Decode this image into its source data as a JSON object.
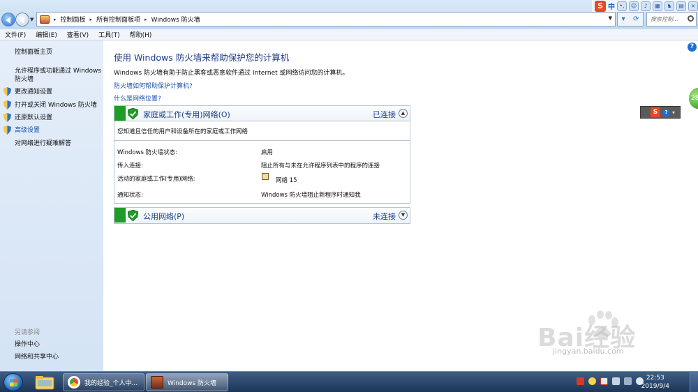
{
  "address": {
    "crumbs": [
      "控制面板",
      "所有控制面板项",
      "Windows 防火墙"
    ],
    "search_placeholder": "搜索控制..."
  },
  "ime": {
    "label": "中"
  },
  "menu": [
    "文件(F)",
    "编辑(E)",
    "查看(V)",
    "工具(T)",
    "帮助(H)"
  ],
  "sidebar": {
    "home": "控制面板主页",
    "items": [
      "允许程序或功能通过 Windows",
      "防火墙",
      "更改通知设置",
      "打开或关闭 Windows 防火墙",
      "还原默认设置",
      "高级设置",
      "对网络进行疑难解答"
    ],
    "see_also_label": "另请参阅",
    "see_also": [
      "操作中心",
      "网络和共享中心"
    ]
  },
  "main": {
    "title": "使用 Windows 防火墙来帮助保护您的计算机",
    "description": "Windows 防火墙有助于防止黑客或恶意软件通过 Internet 或网络访问您的计算机。",
    "link_help": "防火墙如何帮助保护计算机?",
    "link_location": "什么是网络位置?",
    "home_network": {
      "name": "家庭或工作(专用)网络(O)",
      "status": "已连接",
      "desc": "您知道且信任的用户和设备所在的家庭或工作网络",
      "rows": [
        {
          "label": "Windows 防火墙状态:",
          "value": "启用"
        },
        {
          "label": "传入连接:",
          "value": "阻止所有与未在允许程序列表中的程序的连接"
        },
        {
          "label": "活动的家庭或工作(专用)网络:",
          "value": "网络  15"
        },
        {
          "label": "通知状态:",
          "value": "Windows 防火墙阻止新程序时通知我"
        }
      ]
    },
    "public_network": {
      "name": "公用网络(P)",
      "status": "未连接"
    }
  },
  "float_badge": "28",
  "watermark": {
    "text": "Bai经验",
    "sub": "jingyan.baidu.com"
  },
  "taskbar": {
    "items": [
      "我的经验_个人中...",
      "Windows 防火墙"
    ],
    "time": "22:53",
    "date": "2019/9/4"
  },
  "colors": {
    "accent_green": "#1f9b28",
    "title_blue": "#1e3a8a",
    "link_blue": "#1a52a8"
  }
}
